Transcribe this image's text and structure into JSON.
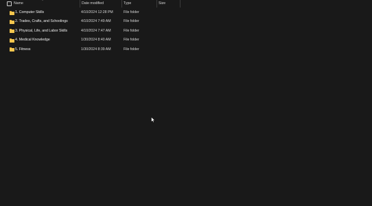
{
  "columns": {
    "name": "Name",
    "date_modified": "Date modified",
    "type": "Type",
    "size": "Size"
  },
  "folders": [
    {
      "name": "1. Computer Skills",
      "date": "4/10/2024 12:28 PM",
      "type": "File folder",
      "size": ""
    },
    {
      "name": "2. Trades, Crafts, and Schoolings",
      "date": "4/10/2024 7:49 AM",
      "type": "File folder",
      "size": ""
    },
    {
      "name": "3. Physical, Life, and Labor Skills",
      "date": "4/10/2024 7:47 AM",
      "type": "File folder",
      "size": ""
    },
    {
      "name": "4. Medical Knowledge",
      "date": "1/30/2024 8:40 AM",
      "type": "File folder",
      "size": ""
    },
    {
      "name": "5. Fitness",
      "date": "1/30/2024 8:39 AM",
      "type": "File folder",
      "size": ""
    }
  ],
  "icons": {
    "folder": "folder-icon",
    "sort": "sort-indicator-icon",
    "cursor": "mouse-cursor-icon"
  },
  "colors": {
    "background": "#191919",
    "folder": "#f4c64e",
    "text": "#f0f0f0"
  }
}
